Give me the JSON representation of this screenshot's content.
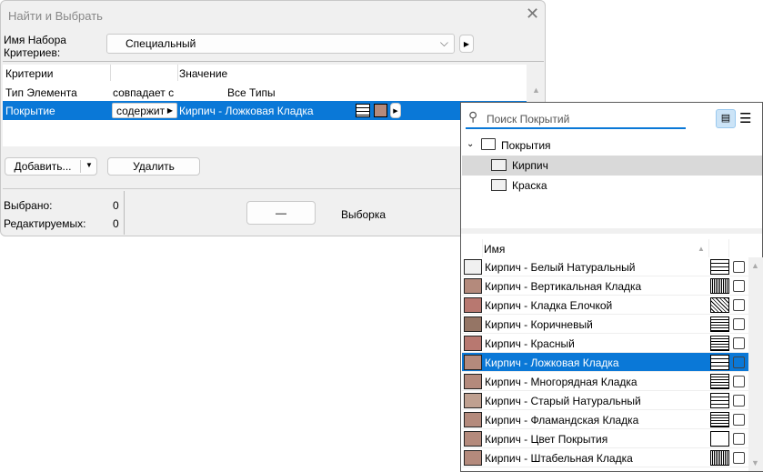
{
  "dialog": {
    "title": "Найти и Выбрать",
    "set_label": "Имя Набора Критериев:",
    "set_value": "Специальный",
    "columns": [
      "Критерии",
      "",
      "Значение"
    ],
    "rows": [
      {
        "criterion": "Тип Элемента",
        "operator": "совпадает с",
        "value": "Все Типы"
      },
      {
        "criterion": "Покрытие",
        "operator": "содержит",
        "value": "Кирпич - Ложковая Кладка"
      }
    ],
    "add_label": "Добавить...",
    "delete_label": "Удалить",
    "selected_label": "Выбрано:",
    "selected_count": "0",
    "editable_label": "Редактируемых:",
    "editable_count": "0",
    "minus_label": "—",
    "selection_label": "Выборка"
  },
  "popup": {
    "search_placeholder": "Поиск Покрытий",
    "tree": {
      "root": "Покрытия",
      "children": [
        "Кирпич",
        "Краска"
      ]
    },
    "name_header": "Имя",
    "items": [
      {
        "name": "Кирпич - Белый Натуральный",
        "color": "#f0f0f0"
      },
      {
        "name": "Кирпич - Вертикальная Кладка",
        "color": "#b48a7c"
      },
      {
        "name": "Кирпич - Кладка Елочкой",
        "color": "#b87870"
      },
      {
        "name": "Кирпич - Коричневый",
        "color": "#957565"
      },
      {
        "name": "Кирпич - Красный",
        "color": "#b87870"
      },
      {
        "name": "Кирпич - Ложковая Кладка",
        "color": "#b48a7c",
        "selected": true
      },
      {
        "name": "Кирпич - Многорядная Кладка",
        "color": "#b48a7c"
      },
      {
        "name": "Кирпич - Старый Натуральный",
        "color": "#bfa090"
      },
      {
        "name": "Кирпич - Фламандская Кладка",
        "color": "#b48a7c"
      },
      {
        "name": "Кирпич - Цвет Покрытия",
        "color": "#b48a7c"
      },
      {
        "name": "Кирпич - Штабельная Кладка",
        "color": "#b48a7c"
      }
    ]
  },
  "colors": {
    "accent": "#0a78d7",
    "swatch": "#b48a7c"
  }
}
